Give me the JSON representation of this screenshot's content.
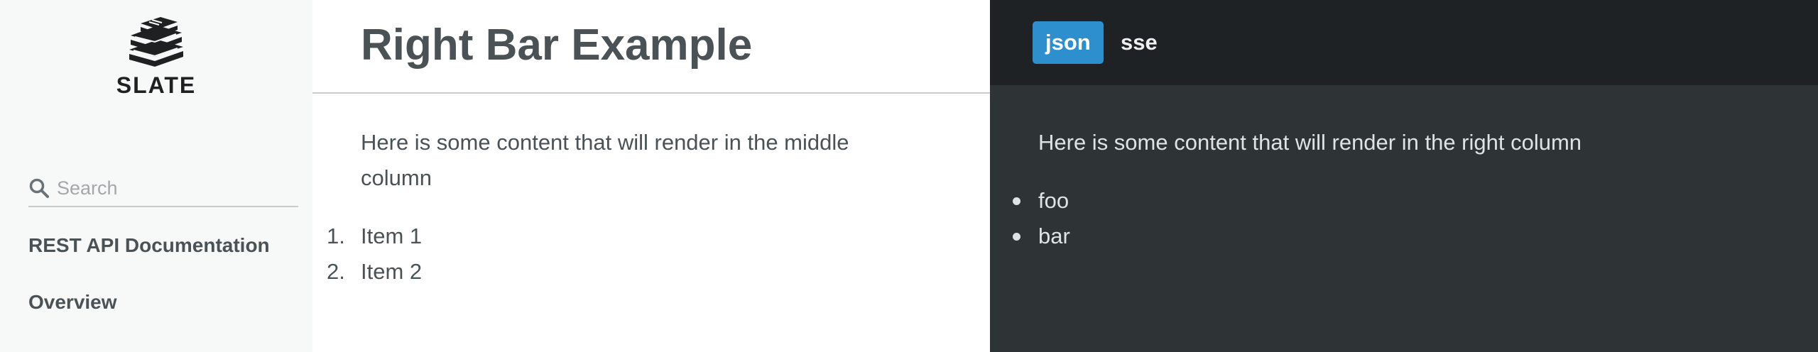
{
  "sidebar": {
    "logo_text": "SLATE",
    "search_placeholder": "Search",
    "nav_items": [
      {
        "label": "REST API Documentation"
      },
      {
        "label": "Overview"
      }
    ]
  },
  "main": {
    "title": "Right Bar Example",
    "content": "Here is some content that will render in the middle column",
    "list": [
      {
        "num": "1.",
        "label": "Item 1"
      },
      {
        "num": "2.",
        "label": "Item 2"
      }
    ]
  },
  "right_bar": {
    "language_tabs": [
      {
        "label": "json",
        "active": true
      },
      {
        "label": "sse",
        "active": false
      }
    ],
    "content": "Here is some content that will render in the right column",
    "list": [
      "foo",
      "bar"
    ]
  },
  "colors": {
    "accent": "#2e8fce",
    "sidebar_bg": "#f7f9f8",
    "right_bg": "#2e3336",
    "right_header_bg": "#1e2224",
    "text": "#4a5256"
  },
  "icons": {
    "logo": "books-stack-icon",
    "search": "magnifier-icon"
  }
}
